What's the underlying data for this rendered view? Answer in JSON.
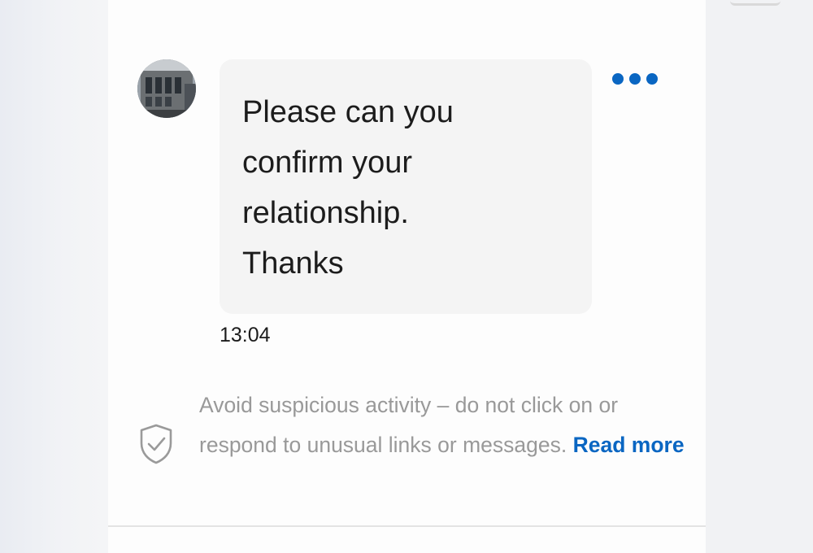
{
  "message": {
    "text": "Please can you\nconfirm your\nrelationship.\nThanks",
    "time": "13:04",
    "more_icon": "more-horizontal-icon"
  },
  "sender": {
    "avatar_icon": "building-photo-avatar"
  },
  "safety_notice": {
    "icon": "shield-check-icon",
    "text": "Avoid suspicious activity – do not click on or respond to unusual links or messages.",
    "link": "Read more"
  },
  "colors": {
    "accent": "#0a66c2",
    "bubble": "#f4f4f4",
    "muted_text": "#999999"
  }
}
